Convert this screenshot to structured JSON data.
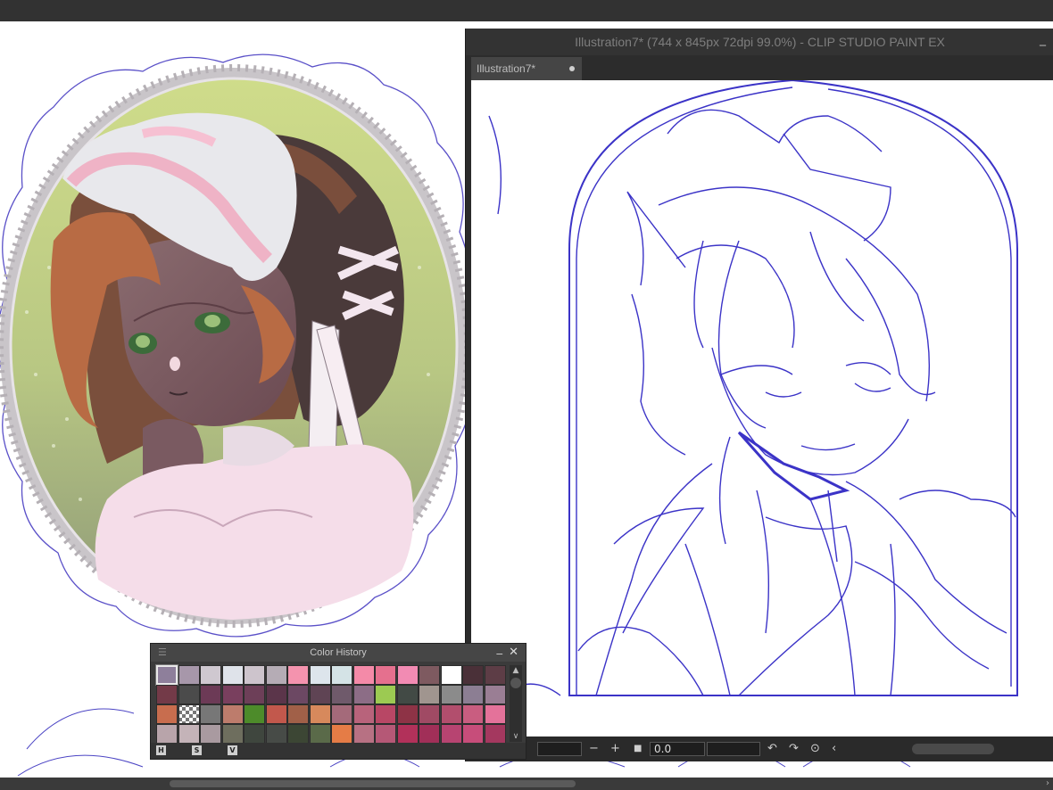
{
  "window": {
    "title": "Illustration7* (744 x 845px 72dpi 99.0%)  - CLIP STUDIO PAINT EX",
    "minimize": "_",
    "tab_label": "Illustration7*"
  },
  "status": {
    "minus": "−",
    "plus": "+",
    "stop": "■",
    "angle_value": "0.0",
    "rotate_left": "↶",
    "rotate_right": "↷",
    "reset_icon": "⊙",
    "prev_icon": "‹"
  },
  "palette": {
    "title": "Color History",
    "menu_icon": "☰",
    "minimize": "_",
    "close": "✕",
    "scroll_up": "▲",
    "scroll_down": "∨",
    "buttons": [
      "H",
      "S",
      "V"
    ],
    "swatches": [
      [
        "#8e7f9b",
        "#a797aa",
        "#cfc8d0",
        "#dfe3ea",
        "#cdc4cc",
        "#b5acb5",
        "#f493ae",
        "#dde5ec",
        "#d4e3e6",
        "#f48aa8",
        "#e5708e",
        "#f28bb3",
        "#7e5a60",
        "#ffffff",
        "#4a3038",
        "#5d3d46"
      ],
      [
        "#733a48",
        "#4b4b4b",
        "#6c3a56",
        "#793f5e",
        "#6d3f58",
        "#5b354a",
        "#6c4863",
        "#5f4454",
        "#6f5a6b",
        "#8c6d86",
        "#9cca52",
        "#424a45",
        "#a0958f",
        "#8b8b8b",
        "#8c7e93",
        "#9a7e94"
      ],
      [
        "#c86d4e",
        "checker",
        "#777777",
        "#bd7c6c",
        "#4d8b2a",
        "#c2584c",
        "#a16048",
        "#d7895c",
        "#a46a7a",
        "#b8637b",
        "#b84765",
        "#8e3346",
        "#a04a64",
        "#b24e6d",
        "#c95d80",
        "#e4729a"
      ],
      [
        "#b8a4aa",
        "#c4b3b8",
        "#a99aa0",
        "#6e6e5e",
        "#3f463e",
        "#474b47",
        "#3c4634",
        "#5a6a49",
        "#e57c46",
        "#b77183",
        "#b55876",
        "#b2315a",
        "#a12f58",
        "#b74471",
        "#c74d7a",
        "#a4385f"
      ]
    ]
  },
  "colors": {
    "sketch_line": "#3b33c7",
    "panel_bg": "#2b2b2b",
    "title_bg": "#333333"
  }
}
